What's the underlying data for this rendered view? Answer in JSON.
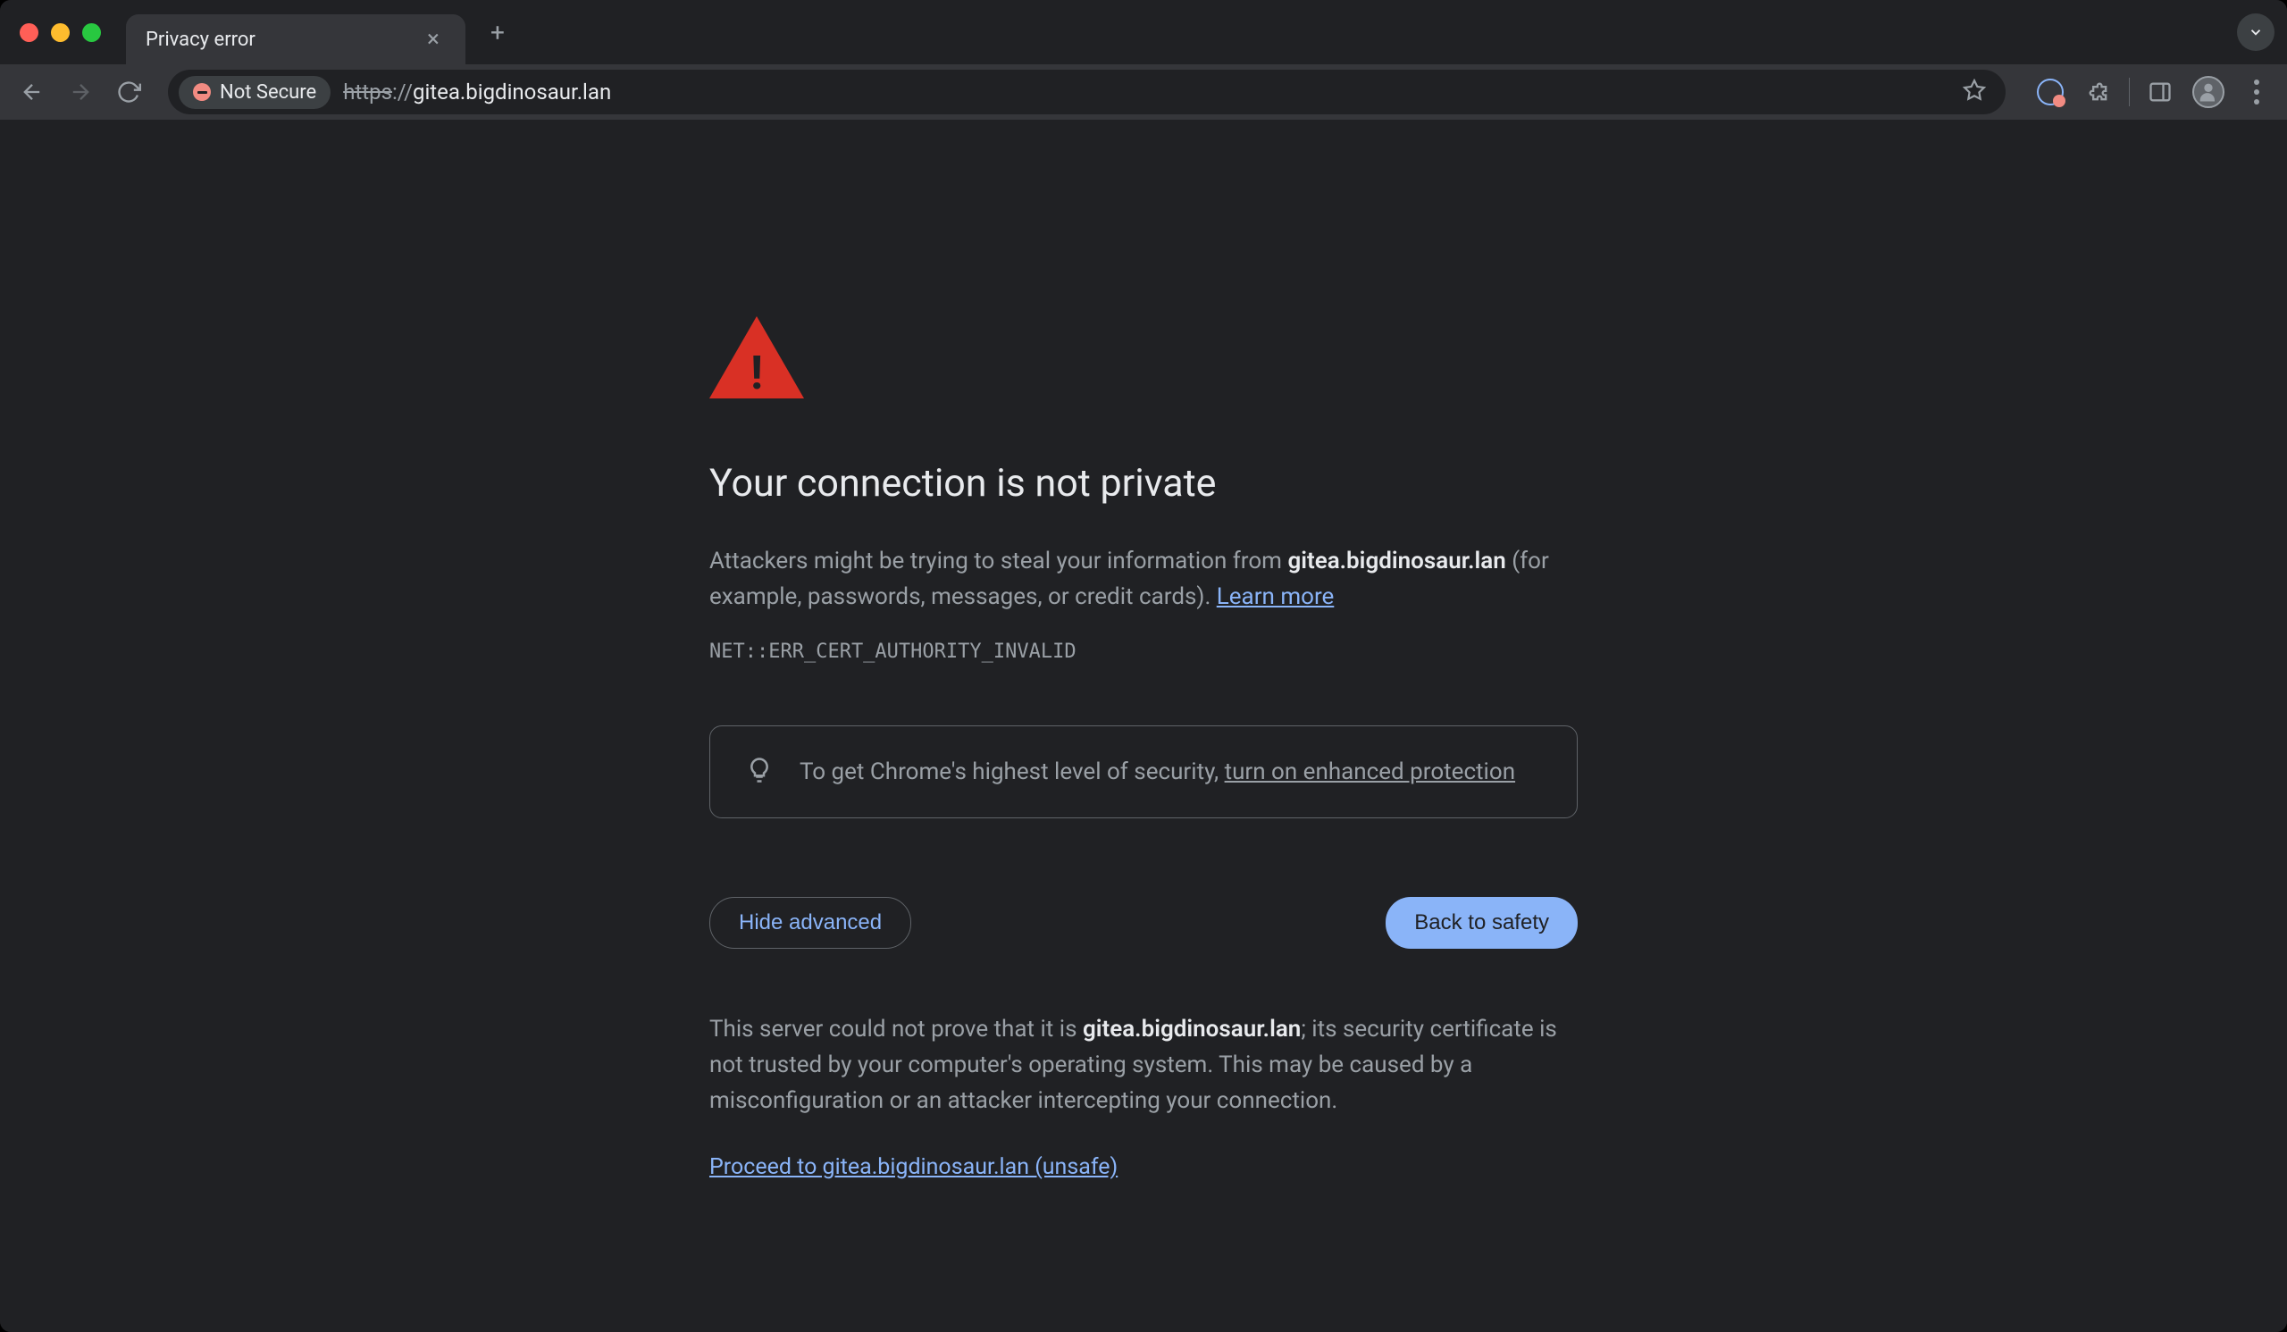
{
  "tab": {
    "title": "Privacy error"
  },
  "omnibox": {
    "security_label": "Not Secure",
    "url_scheme": "https",
    "url_sep": "://",
    "url_host": "gitea.bigdinosaur.lan"
  },
  "interstitial": {
    "headline": "Your connection is not private",
    "body_prefix": "Attackers might be trying to steal your information from ",
    "body_host": "gitea.bigdinosaur.lan",
    "body_suffix": " (for example, passwords, messages, or credit cards). ",
    "learn_more": "Learn more",
    "error_code": "NET::ERR_CERT_AUTHORITY_INVALID",
    "tip_prefix": "To get Chrome's highest level of security, ",
    "tip_link": "turn on enhanced protection",
    "hide_advanced": "Hide advanced",
    "back_to_safety": "Back to safety",
    "advanced_prefix": "This server could not prove that it is ",
    "advanced_host": "gitea.bigdinosaur.lan",
    "advanced_suffix": "; its security certificate is not trusted by your computer's operating system. This may be caused by a misconfiguration or an attacker intercepting your connection.",
    "proceed_link": "Proceed to gitea.bigdinosaur.lan (unsafe)"
  }
}
